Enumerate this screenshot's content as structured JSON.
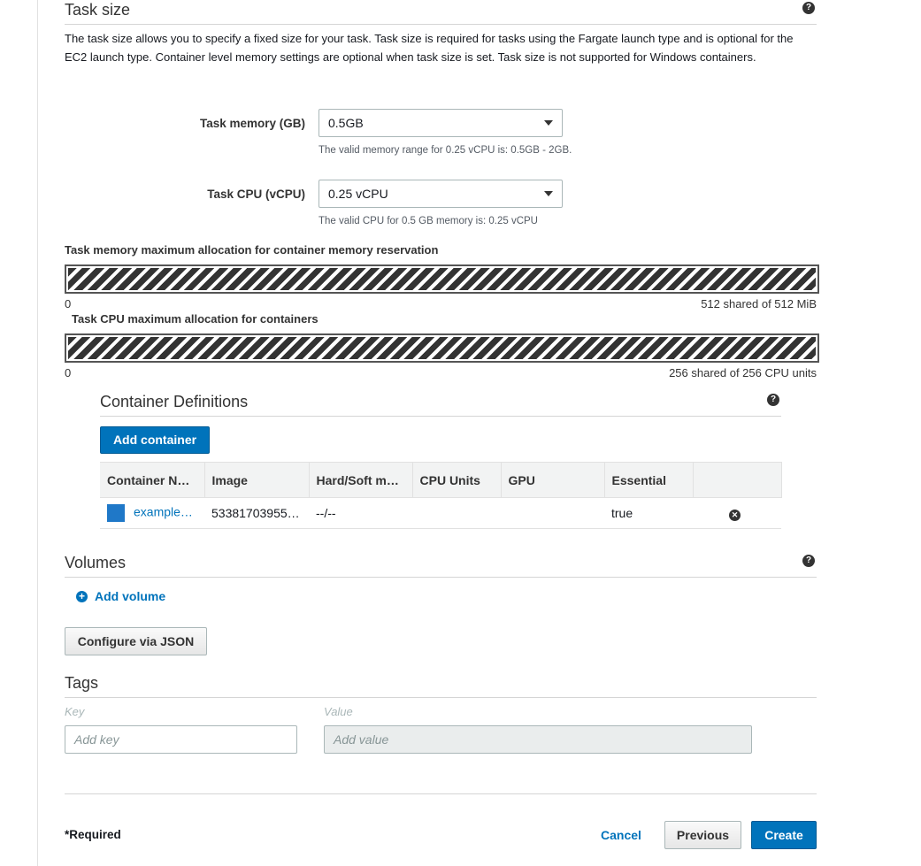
{
  "task_size": {
    "title": "Task size",
    "description": "The task size allows you to specify a fixed size for your task. Task size is required for tasks using the Fargate launch type and is optional for the EC2 launch type. Container level memory settings are optional when task size is set. Task size is not supported for Windows containers.",
    "memory": {
      "label": "Task memory (GB)",
      "value": "0.5GB",
      "hint": "The valid memory range for 0.25 vCPU is: 0.5GB - 2GB."
    },
    "cpu": {
      "label": "Task CPU (vCPU)",
      "value": "0.25 vCPU",
      "hint": "The valid CPU for 0.5 GB memory is: 0.25 vCPU"
    }
  },
  "allocation": {
    "memory": {
      "label": "Task memory maximum allocation for container memory reservation",
      "min": "0",
      "max_text": "512 shared of 512 MiB",
      "fill_fraction": 1.0
    },
    "cpu": {
      "label": "Task CPU maximum allocation for containers",
      "min": "0",
      "max_text": "256 shared of 256 CPU units",
      "fill_fraction": 1.0
    }
  },
  "container_definitions": {
    "title": "Container Definitions",
    "add_button": "Add container",
    "columns": [
      "Container N…",
      "Image",
      "Hard/Soft m…",
      "CPU Units",
      "GPU",
      "Essential",
      ""
    ],
    "rows": [
      {
        "name": "example…",
        "image": "53381703955…",
        "memory": "--/--",
        "cpu": "",
        "gpu": "",
        "essential": "true",
        "swatch_color": "#1f78c8"
      }
    ]
  },
  "volumes": {
    "title": "Volumes",
    "add_link": "Add volume"
  },
  "configure_json_button": "Configure via JSON",
  "tags": {
    "title": "Tags",
    "key_label": "Key",
    "value_label": "Value",
    "key_placeholder": "Add key",
    "value_placeholder": "Add value"
  },
  "footer": {
    "required_text": "*Required",
    "cancel": "Cancel",
    "previous": "Previous",
    "create": "Create"
  },
  "colors": {
    "accent": "#0073bb",
    "stripe": "#333333"
  }
}
